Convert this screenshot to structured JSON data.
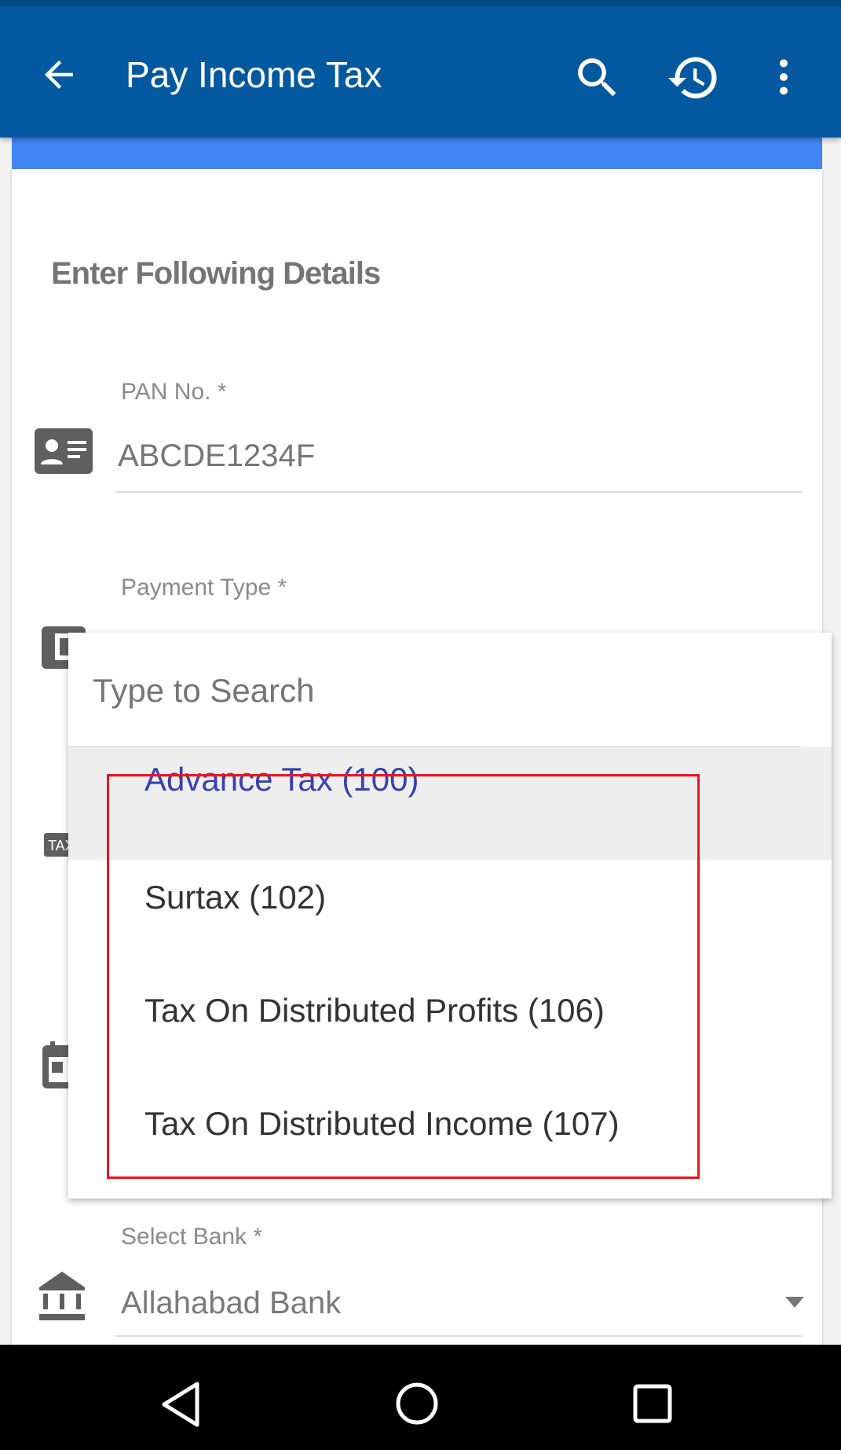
{
  "app_bar": {
    "title": "Pay Income Tax",
    "icons": [
      "back-arrow-icon",
      "search-icon",
      "history-icon",
      "more-vert-icon"
    ]
  },
  "form": {
    "heading": "Enter Following Details",
    "pan": {
      "label": "PAN No. *",
      "placeholder": "ABCDE1234F"
    },
    "payment_type": {
      "label": "Payment Type *"
    },
    "bank": {
      "label": "Select Bank *",
      "value": "Allahabad Bank"
    }
  },
  "dropdown": {
    "search_placeholder": "Type to Search",
    "options": [
      "Advance Tax (100)",
      "Surtax (102)",
      "Tax On Distributed Profits (106)",
      "Tax On Distributed Income (107)"
    ],
    "selected": "Advance Tax (100)"
  },
  "colors": {
    "app_bar": "#03599f",
    "accent_strip": "#4285f4",
    "selected_option": "#3443b0",
    "highlight_box": "#e8141e"
  }
}
